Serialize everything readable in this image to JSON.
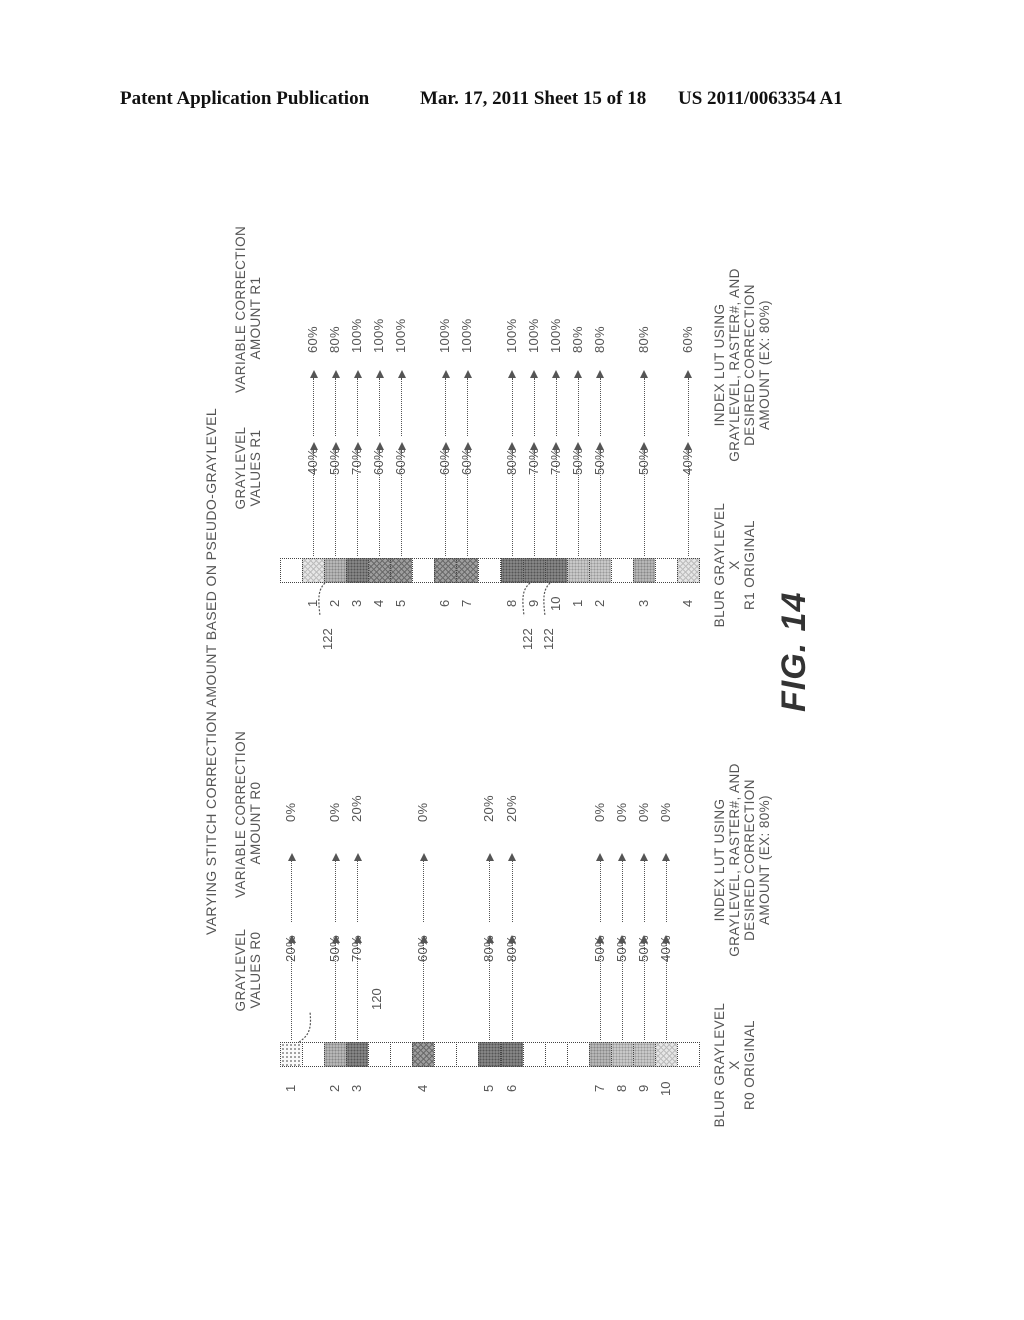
{
  "header": {
    "publication": "Patent Application Publication",
    "date_sheet": "Mar. 17, 2011  Sheet 15 of 18",
    "number": "US 2011/0063354 A1"
  },
  "figure": {
    "title": "VARYING STITCH CORRECTION AMOUNT BASED ON PSEUDO-GRAYLEVEL",
    "label": "FIG. 14",
    "r0": {
      "col_header_values": [
        "GRAYLEVEL",
        "VALUES R0"
      ],
      "col_header_correction": [
        "VARIABLE CORRECTION",
        "AMOUNT R0"
      ],
      "ref_label": "120",
      "strip_cells": [
        "stipple",
        "white",
        "medium",
        "dark",
        "white",
        "white",
        "darkx",
        "white",
        "white",
        "dark",
        "dark",
        "white",
        "white",
        "white",
        "medium",
        "medlight",
        "medlight",
        "lightx",
        "white"
      ],
      "rows": [
        {
          "num": "1",
          "cell": 0,
          "gray": "20%",
          "corr": "0%"
        },
        {
          "num": "2",
          "cell": 2,
          "gray": "50%",
          "corr": "0%"
        },
        {
          "num": "3",
          "cell": 3,
          "gray": "70%",
          "corr": "20%"
        },
        {
          "num": "4",
          "cell": 6,
          "gray": "60%",
          "corr": "0%"
        },
        {
          "num": "5",
          "cell": 9,
          "gray": "80%",
          "corr": "20%"
        },
        {
          "num": "6",
          "cell": 10,
          "gray": "80%",
          "corr": "20%"
        },
        {
          "num": "7",
          "cell": 14,
          "gray": "50%",
          "corr": "0%"
        },
        {
          "num": "8",
          "cell": 15,
          "gray": "50%",
          "corr": "0%"
        },
        {
          "num": "9",
          "cell": 16,
          "gray": "50%",
          "corr": "0%"
        },
        {
          "num": "10",
          "cell": 17,
          "gray": "40%",
          "corr": "0%"
        }
      ],
      "footer_left": [
        "BLUR GRAYLEVEL",
        "X",
        "R0 ORIGINAL"
      ],
      "footer_right": [
        "INDEX LUT USING",
        "GRAYLEVEL, RASTER#, AND",
        "DESIRED CORRECTION",
        "AMOUNT (EX: 80%)"
      ]
    },
    "r1": {
      "col_header_values": [
        "GRAYLEVEL",
        "VALUES R1"
      ],
      "col_header_correction": [
        "VARIABLE CORRECTION",
        "AMOUNT R1"
      ],
      "ref_labels": [
        "122",
        "122",
        "122"
      ],
      "strip_cells": [
        "white",
        "lightx",
        "medium",
        "dark",
        "darkx",
        "darkx",
        "white",
        "darkx",
        "darkx",
        "white",
        "dark",
        "dark",
        "dark",
        "medlight",
        "medlight",
        "white",
        "medium",
        "white",
        "lightx"
      ],
      "rows": [
        {
          "num": "1",
          "cell": 1,
          "gray": "40%",
          "corr": "60%"
        },
        {
          "num": "2",
          "cell": 2,
          "gray": "50%",
          "corr": "80%"
        },
        {
          "num": "3",
          "cell": 3,
          "gray": "70%",
          "corr": "100%"
        },
        {
          "num": "4",
          "cell": 4,
          "gray": "60%",
          "corr": "100%"
        },
        {
          "num": "5",
          "cell": 5,
          "gray": "60%",
          "corr": "100%"
        },
        {
          "num": "6",
          "cell": 7,
          "gray": "60%",
          "corr": "100%"
        },
        {
          "num": "7",
          "cell": 8,
          "gray": "60%",
          "corr": "100%"
        },
        {
          "num": "8",
          "cell": 10,
          "gray": "80%",
          "corr": "100%"
        },
        {
          "num": "9",
          "cell": 11,
          "gray": "70%",
          "corr": "100%"
        },
        {
          "num": "10",
          "cell": 12,
          "gray": "70%",
          "corr": "100%"
        },
        {
          "num": "1",
          "cell": 13,
          "gray": "50%",
          "corr": "80%"
        },
        {
          "num": "2",
          "cell": 14,
          "gray": "50%",
          "corr": "80%"
        },
        {
          "num": "3",
          "cell": 16,
          "gray": "50%",
          "corr": "80%"
        },
        {
          "num": "4",
          "cell": 18,
          "gray": "40%",
          "corr": "60%"
        }
      ],
      "footer_left": [
        "BLUR GRAYLEVEL",
        "X",
        "R1 ORIGINAL"
      ],
      "footer_right": [
        "INDEX LUT USING",
        "GRAYLEVEL, RASTER#, AND",
        "DESIRED CORRECTION",
        "AMOUNT (EX: 80%)"
      ]
    }
  }
}
